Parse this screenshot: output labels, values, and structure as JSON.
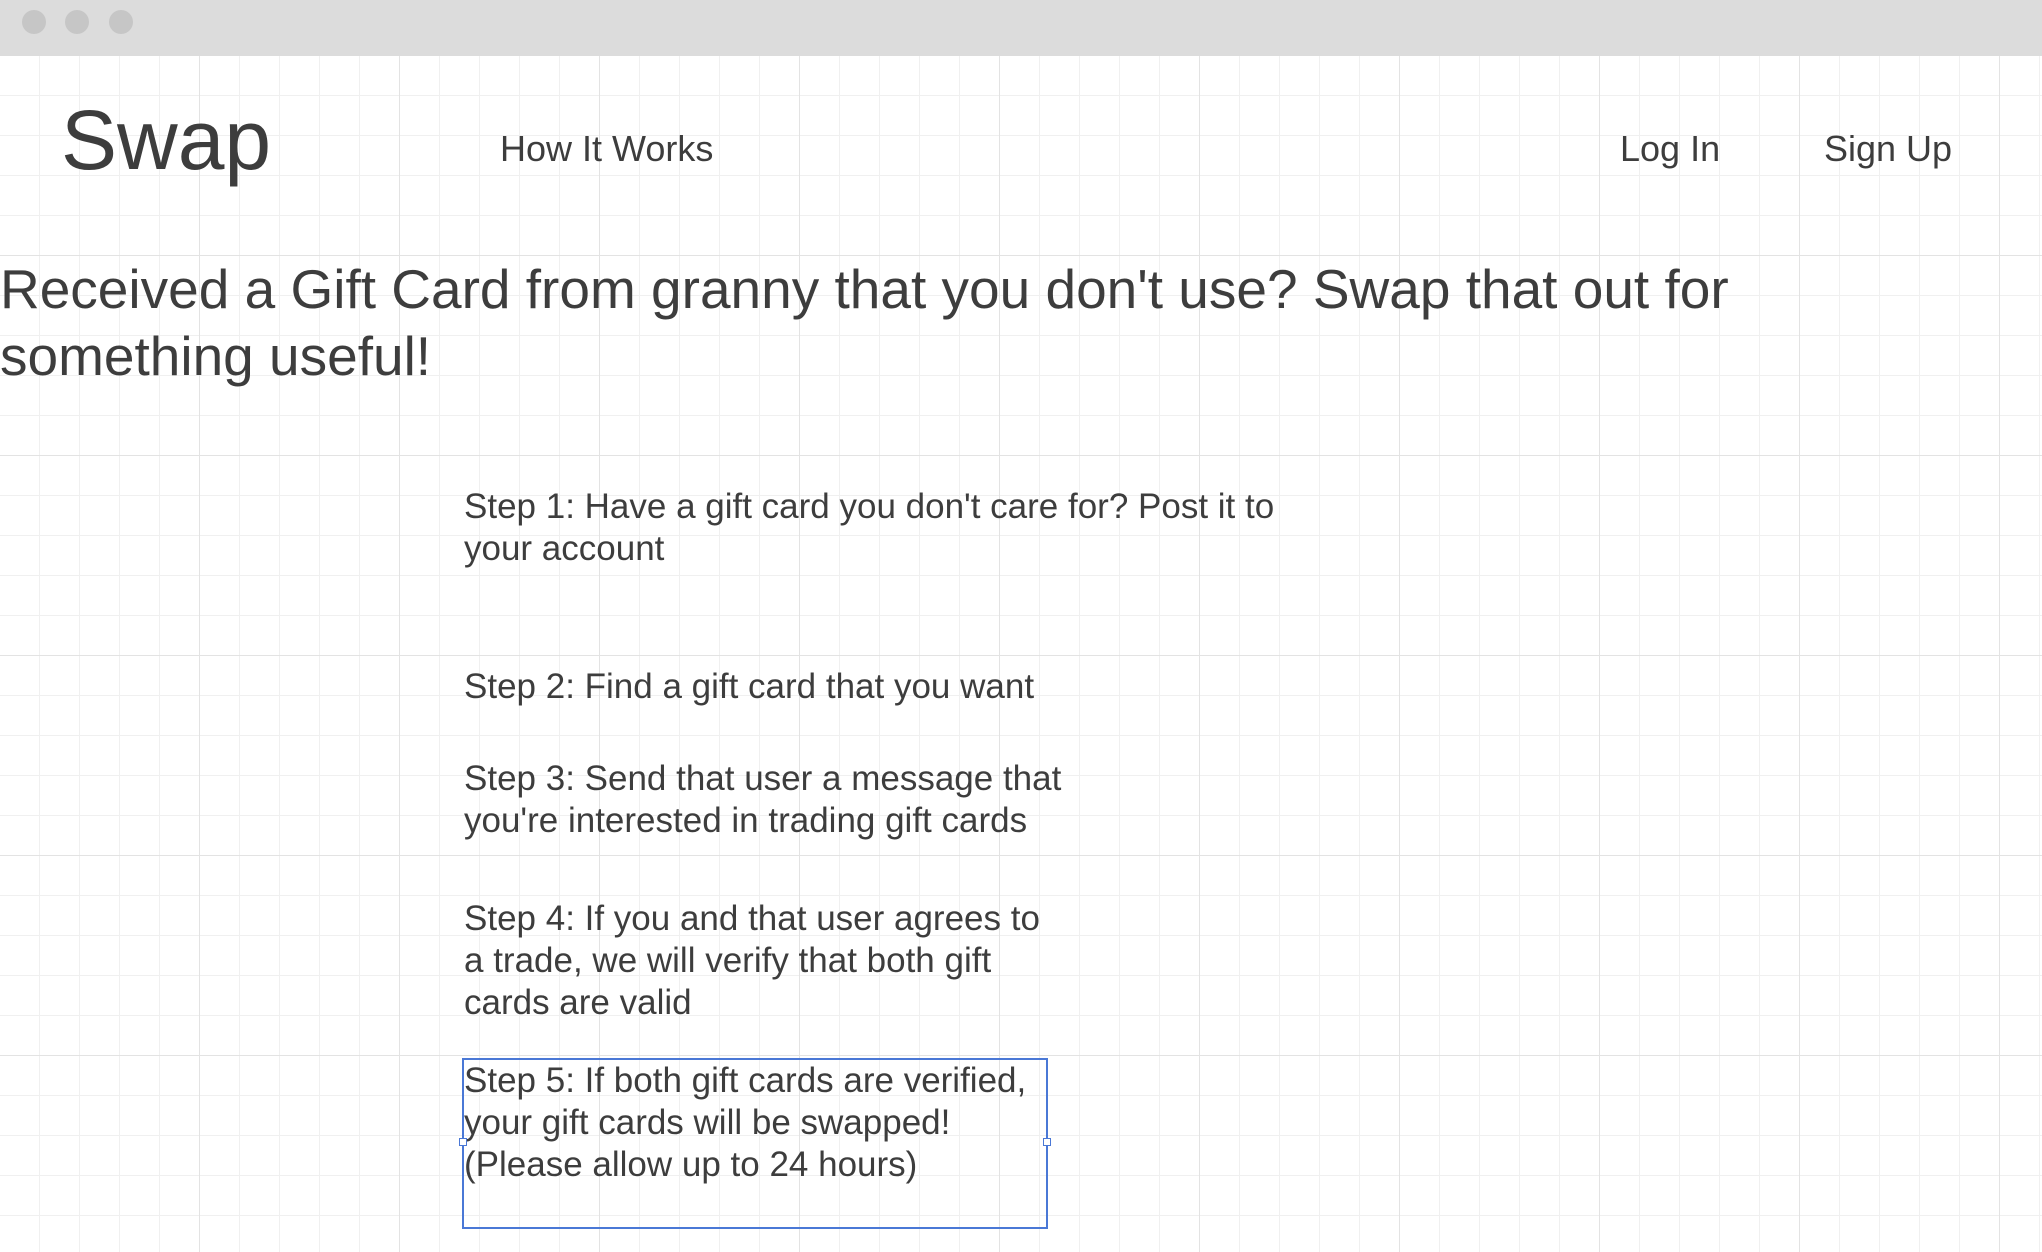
{
  "brand": {
    "logo_text": "Swap"
  },
  "nav": {
    "how_it_works": "How It Works",
    "log_in": "Log In",
    "sign_up": "Sign Up"
  },
  "hero": {
    "headline": "Received a Gift Card from granny that you don't use? Swap that out for something useful!"
  },
  "steps": [
    "Step 1: Have a gift card you don't care for? Post it to your account",
    "Step 2: Find a gift card that you want",
    "Step 3: Send that user a message that you're interested in trading gift cards",
    "Step 4: If you and that user agrees to a trade, we will verify that both gift cards are valid",
    "Step 5: If both gift cards are verified, your gift cards will be swapped! (Please allow up to 24 hours)"
  ]
}
